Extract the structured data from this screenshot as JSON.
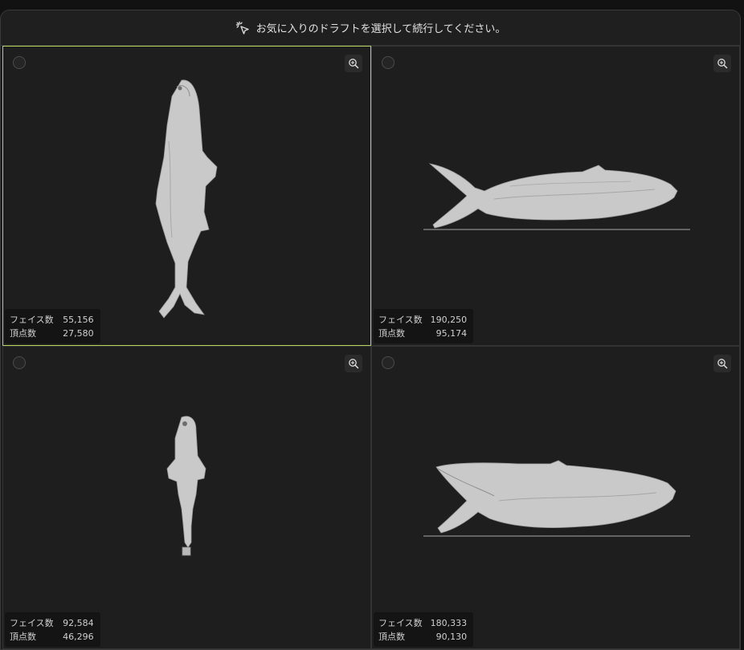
{
  "header": {
    "icon": "select-pointer-icon",
    "text": "お気に入りのドラフトを選択して続行してください。"
  },
  "drafts": [
    {
      "selected": true,
      "model_view": "top",
      "faces_label": "フェイス数",
      "faces": "55,156",
      "vertices_label": "頂点数",
      "vertices": "27,580"
    },
    {
      "selected": false,
      "model_view": "side",
      "faces_label": "フェイス数",
      "faces": "190,250",
      "vertices_label": "頂点数",
      "vertices": "95,174"
    },
    {
      "selected": false,
      "model_view": "top",
      "faces_label": "フェイス数",
      "faces": "92,584",
      "vertices_label": "頂点数",
      "vertices": "46,296"
    },
    {
      "selected": false,
      "model_view": "side",
      "faces_label": "フェイス数",
      "faces": "180,333",
      "vertices_label": "頂点数",
      "vertices": "90,130"
    }
  ],
  "colors": {
    "selected_border": "#b6d45c",
    "background": "#1e1e1e",
    "model": "#c8c8c8"
  }
}
